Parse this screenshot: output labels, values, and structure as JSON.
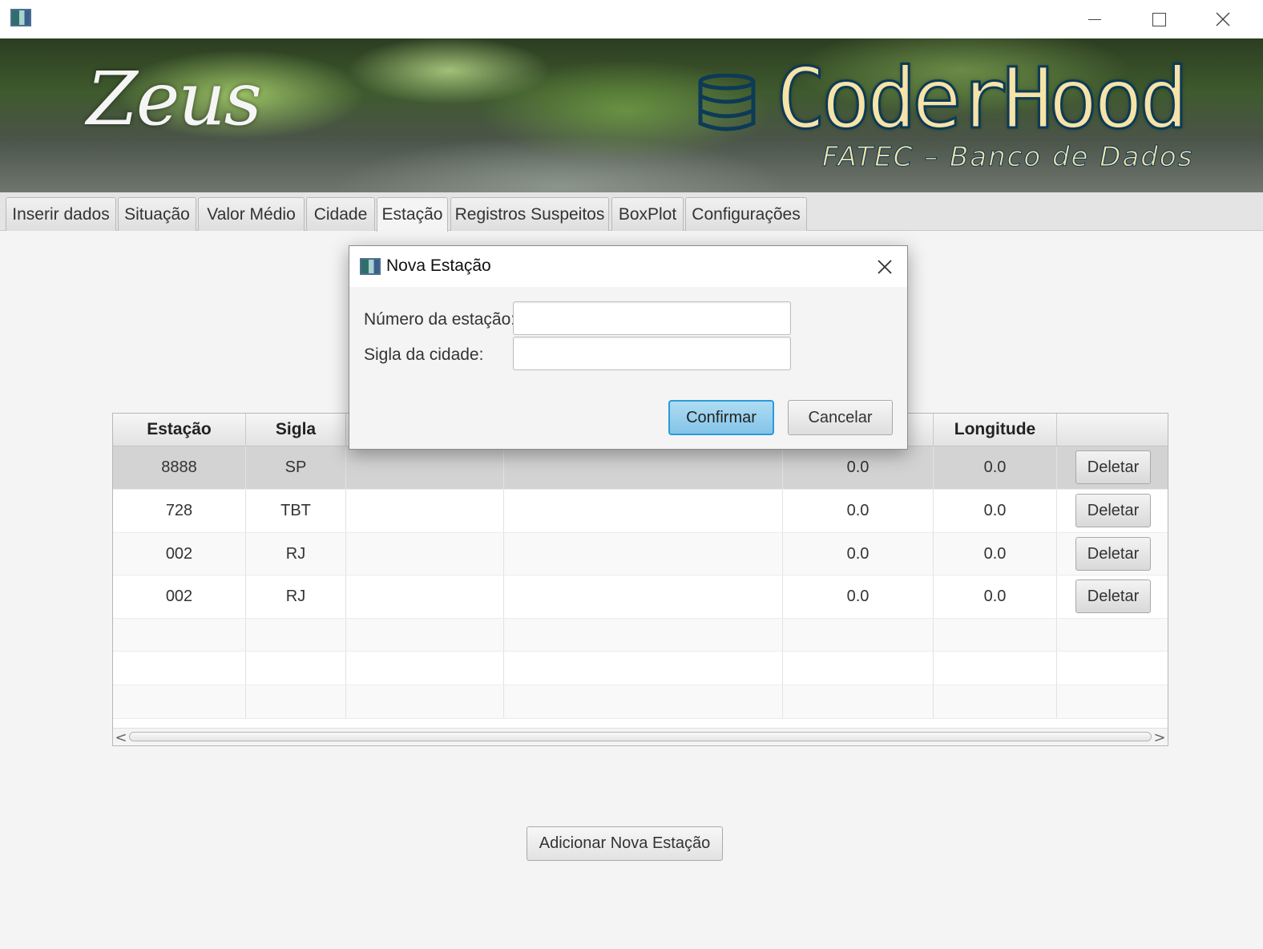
{
  "window": {
    "icon": "app-icon",
    "controls": {
      "minimize": "minimize-icon",
      "maximize": "maximize-icon",
      "close": "close-icon"
    }
  },
  "banner": {
    "left_title": "Zeus",
    "brand": "CoderHood",
    "subtitle": "FATEC – Banco de Dados",
    "brand_icon": "database-icon",
    "colors": {
      "brand_text": "#f6e3a8",
      "brand_outline": "#0d3a57"
    }
  },
  "tabs": [
    {
      "label": "Inserir dados",
      "active": false
    },
    {
      "label": "Situação",
      "active": false
    },
    {
      "label": "Valor Médio",
      "active": false
    },
    {
      "label": "Cidade",
      "active": false
    },
    {
      "label": "Estação",
      "active": true
    },
    {
      "label": "Registros Suspeitos",
      "active": false
    },
    {
      "label": "BoxPlot",
      "active": false
    },
    {
      "label": "Configurações",
      "active": false
    }
  ],
  "table": {
    "columns": [
      "Estação",
      "Sigla",
      "",
      "",
      "",
      "Longitude",
      ""
    ],
    "rows": [
      {
        "estacao": "8888",
        "sigla": "SP",
        "c5": "0.0",
        "longitude": "0.0",
        "action": "Deletar",
        "selected": true
      },
      {
        "estacao": "728",
        "sigla": "TBT",
        "c5": "0.0",
        "longitude": "0.0",
        "action": "Deletar"
      },
      {
        "estacao": "002",
        "sigla": "RJ",
        "c5": "0.0",
        "longitude": "0.0",
        "action": "Deletar"
      },
      {
        "estacao": "002",
        "sigla": "RJ",
        "c5": "0.0",
        "longitude": "0.0",
        "action": "Deletar"
      }
    ],
    "scroll_left": "<",
    "scroll_right": ">"
  },
  "add_button": "Adicionar Nova Estação",
  "dialog": {
    "title": "Nova Estação",
    "close": "×",
    "fields": [
      {
        "label": "Número da estação:",
        "value": ""
      },
      {
        "label": "Sigla da cidade:",
        "value": ""
      }
    ],
    "confirm": "Confirmar",
    "cancel": "Cancelar",
    "colors": {
      "confirm_bg": "#9ad1ee",
      "confirm_border": "#2d9ad6"
    }
  }
}
